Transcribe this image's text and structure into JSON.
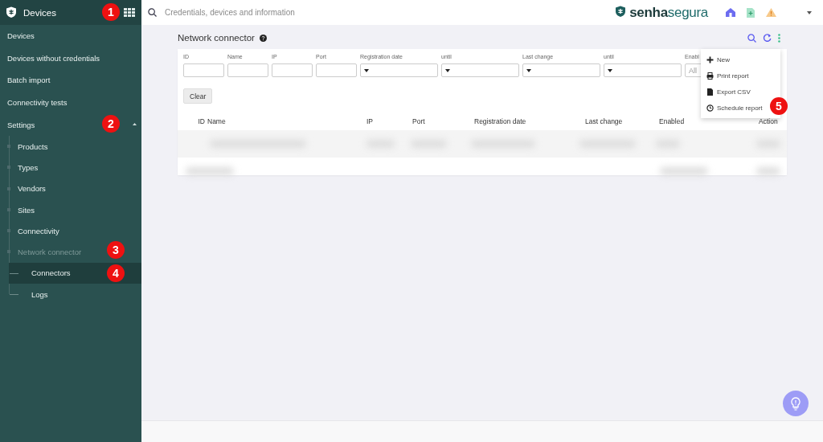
{
  "sidebar": {
    "title": "Devices",
    "items": [
      {
        "label": "Devices",
        "selected": false,
        "greyed": false
      },
      {
        "label": "Devices without credentials",
        "selected": false,
        "greyed": false
      },
      {
        "label": "Batch import",
        "selected": false,
        "greyed": false
      },
      {
        "label": "Connectivity tests",
        "selected": false,
        "greyed": false
      },
      {
        "label": "Settings",
        "selected": false,
        "expanded": true,
        "greyed": false,
        "children": [
          {
            "label": "Products",
            "selected": false,
            "greyed": false
          },
          {
            "label": "Types",
            "selected": false,
            "greyed": false
          },
          {
            "label": "Vendors",
            "selected": false,
            "greyed": false
          },
          {
            "label": "Sites",
            "selected": false,
            "greyed": false
          },
          {
            "label": "Connectivity",
            "selected": false,
            "greyed": false
          },
          {
            "label": "Network connector",
            "selected": false,
            "greyed": true,
            "children": [
              {
                "label": "Connectors",
                "selected": true,
                "greyed": false
              },
              {
                "label": "Logs",
                "selected": false,
                "greyed": false
              }
            ]
          }
        ]
      }
    ]
  },
  "topbar": {
    "search": {
      "placeholder": "Credentials, devices and information"
    },
    "logo": "**senha**segura"
  },
  "page": {
    "title": "Network connector",
    "filters": [
      {
        "label": "ID",
        "kind": "text"
      },
      {
        "label": "Name",
        "kind": "text"
      },
      {
        "label": "IP",
        "kind": "text"
      },
      {
        "label": "Port",
        "kind": "text"
      },
      {
        "label": "Registration date",
        "kind": "date"
      },
      {
        "label": "until",
        "kind": "date"
      },
      {
        "label": "Last change",
        "kind": "date"
      },
      {
        "label": "until",
        "kind": "date"
      },
      {
        "label": "Enabl",
        "kind": "select",
        "value": "All"
      }
    ],
    "clear_button": "Clear",
    "table": {
      "columns": [
        "ID",
        "Name",
        "IP",
        "Port",
        "Registration date",
        "Last change",
        "Enabled",
        "Action"
      ],
      "rows": [
        {
          "kind": "blurred"
        },
        {
          "kind": "blurred"
        }
      ]
    },
    "menu": [
      "New",
      "Print report",
      "Export CSV",
      "Schedule report"
    ]
  },
  "markers": [
    "1",
    "2",
    "3",
    "4",
    "5"
  ]
}
